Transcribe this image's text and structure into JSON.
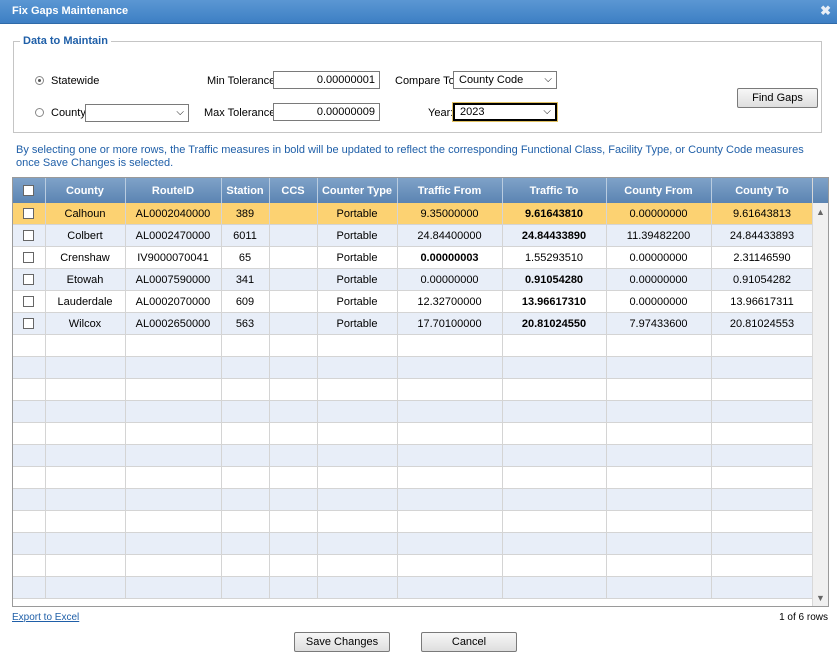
{
  "window": {
    "title": "Fix Gaps Maintenance",
    "close_glyph": "✖"
  },
  "data_to_maintain": {
    "legend": "Data to Maintain",
    "statewide_label": "Statewide",
    "county_label": "County",
    "county_value": "",
    "min_tolerance_label": "Min Tolerance:",
    "min_tolerance_value": "0.00000001",
    "max_tolerance_label": "Max Tolerance:",
    "max_tolerance_value": "0.00000009",
    "compare_to_label": "Compare To:",
    "compare_to_value": "County Code",
    "year_label": "Year:",
    "year_value": "2023",
    "find_gaps_label": "Find Gaps"
  },
  "info_text": "By selecting one or more rows, the Traffic measures in bold will be updated to reflect the corresponding Functional Class, Facility Type, or County Code measures once Save Changes is selected.",
  "grid": {
    "columns": [
      "County",
      "RouteID",
      "Station",
      "CCS",
      "Counter Type",
      "Traffic From",
      "Traffic To",
      "County From",
      "County To"
    ],
    "rows": [
      [
        "Calhoun",
        "AL0002040000",
        "389",
        "",
        "Portable",
        "9.35000000",
        "9.61643810",
        "0.00000000",
        "9.61643813"
      ],
      [
        "Colbert",
        "AL0002470000",
        "6011",
        "",
        "Portable",
        "24.84400000",
        "24.84433890",
        "11.39482200",
        "24.84433893"
      ],
      [
        "Crenshaw",
        "IV9000070041",
        "65",
        "",
        "Portable",
        "0.00000003",
        "1.55293510",
        "0.00000000",
        "2.31146590"
      ],
      [
        "Etowah",
        "AL0007590000",
        "341",
        "",
        "Portable",
        "0.00000000",
        "0.91054280",
        "0.00000000",
        "0.91054282"
      ],
      [
        "Lauderdale",
        "AL0002070000",
        "609",
        "",
        "Portable",
        "12.32700000",
        "13.96617310",
        "0.00000000",
        "13.96617311"
      ],
      [
        "Wilcox",
        "AL0002650000",
        "563",
        "",
        "Portable",
        "17.70100000",
        "20.81024550",
        "7.97433600",
        "20.81024553"
      ]
    ],
    "bold_cells": [
      [
        0,
        6
      ],
      [
        1,
        6
      ],
      [
        2,
        5
      ],
      [
        3,
        6
      ],
      [
        4,
        6
      ],
      [
        5,
        6
      ]
    ],
    "selected_row": 0,
    "empty_row_count": 12
  },
  "footer": {
    "export_label": "Export to Excel",
    "row_count_label": "1 of 6 rows",
    "save_label": "Save Changes",
    "cancel_label": "Cancel"
  },
  "icons": {
    "radio": "radio-icon",
    "checkbox": "checkbox-icon",
    "dropdown": "chevron-down-icon",
    "scroll_up": "scroll-up-arrow-icon",
    "scroll_down": "scroll-down-arrow-icon"
  },
  "colors": {
    "title_bar": "#4a8bcb",
    "header": "#6a92bf",
    "selected_row": "#fcd272",
    "alt_row": "#e8eef8",
    "link": "#1f5fa8"
  }
}
